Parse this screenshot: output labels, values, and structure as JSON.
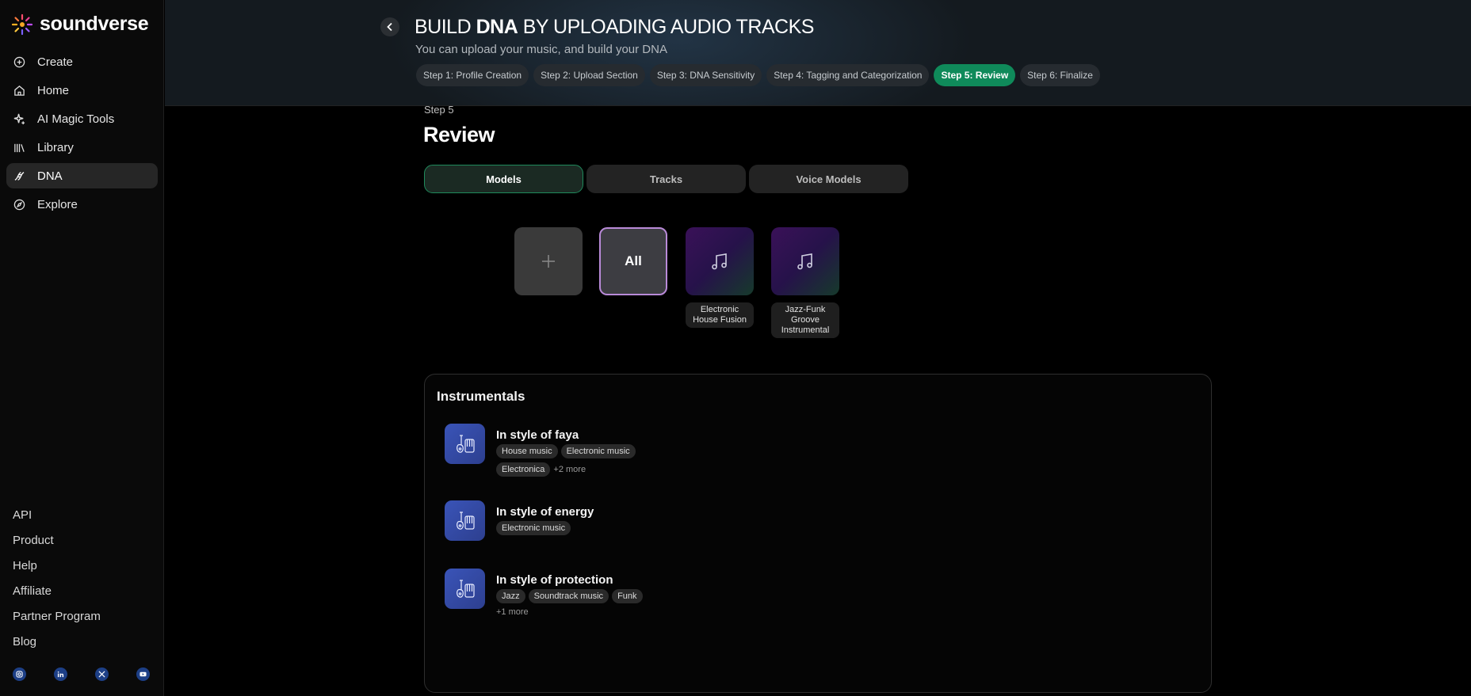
{
  "brand": {
    "name": "soundverse"
  },
  "nav": [
    {
      "label": "Create",
      "icon": "plus-circle-icon"
    },
    {
      "label": "Home",
      "icon": "home-icon"
    },
    {
      "label": "AI Magic Tools",
      "icon": "sparkle-icon"
    },
    {
      "label": "Library",
      "icon": "library-icon"
    },
    {
      "label": "DNA",
      "icon": "dna-icon",
      "active": true
    },
    {
      "label": "Explore",
      "icon": "compass-icon"
    }
  ],
  "footer_links": [
    "API",
    "Product",
    "Help",
    "Affiliate",
    "Partner Program",
    "Blog"
  ],
  "socials": [
    "instagram-icon",
    "linkedin-icon",
    "x-icon",
    "youtube-icon"
  ],
  "header": {
    "title_pre": "BUILD ",
    "title_bold": "DNA",
    "title_post": " BY UPLOADING AUDIO TRACKS",
    "subtitle": "You can upload your music, and build your DNA",
    "steps": [
      "Step 1: Profile Creation",
      "Step 2: Upload Section",
      "Step 3: DNA Sensitivity",
      "Step 4: Tagging and Categorization",
      "Step 5: Review",
      "Step 6: Finalize"
    ],
    "active_step": 4
  },
  "main": {
    "step_label": "Step 5",
    "title": "Review",
    "tabs": [
      "Models",
      "Tracks",
      "Voice Models"
    ],
    "active_tab": 0,
    "models": {
      "all_label": "All",
      "items": [
        "Electronic House Fusion",
        "Jazz-Funk Groove Instrumental"
      ]
    },
    "panel": {
      "title": "Instrumentals",
      "items": [
        {
          "name": "In style of faya",
          "tags": [
            "House music",
            "Electronic music",
            "Electronica"
          ],
          "more": "+2 more"
        },
        {
          "name": "In style of energy",
          "tags": [
            "Electronic music"
          ],
          "more": ""
        },
        {
          "name": "In style of protection",
          "tags": [
            "Jazz",
            "Soundtrack music",
            "Funk"
          ],
          "more": "+1 more"
        }
      ]
    }
  },
  "colors": {
    "accent": "#0f8a5a",
    "highlight": "#b98ad8",
    "instrument_icon": "#3a54b8"
  }
}
